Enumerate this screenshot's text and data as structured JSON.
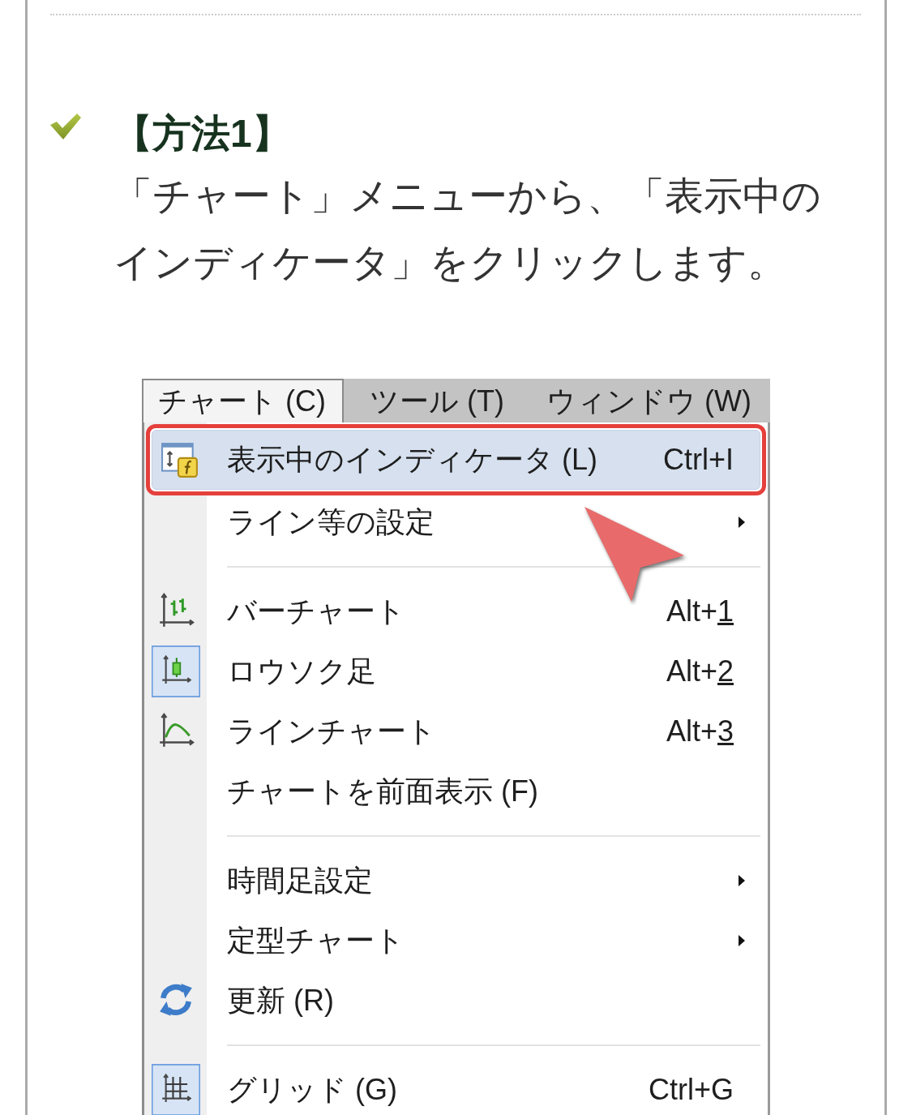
{
  "section": {
    "heading": "【方法1】",
    "text": "「チャート」メニューから、「表示中のインディケータ」をクリックします。"
  },
  "menu_bar": [
    {
      "label": "チャート (C)",
      "selected": true
    },
    {
      "label": "ツール (T)",
      "selected": false
    },
    {
      "label": "ウィンドウ (W)",
      "selected": false
    }
  ],
  "menu_groups": [
    {
      "items": [
        {
          "label": "表示中のインディケータ (L)",
          "shortcut": {
            "text": "Ctrl+I",
            "key_underlined": false
          },
          "selected": true,
          "outlined": true,
          "checked": false,
          "submenu": false
        },
        {
          "label": "ライン等の設定",
          "selected": false,
          "outlined": false,
          "checked": false,
          "submenu": true
        }
      ]
    },
    {
      "items": [
        {
          "label": "バーチャート",
          "shortcut": {
            "text": "Alt+1",
            "key_underlined": true
          },
          "selected": false,
          "outlined": false,
          "checked": false,
          "submenu": false
        },
        {
          "label": "ロウソク足",
          "shortcut": {
            "text": "Alt+2",
            "key_underlined": true
          },
          "selected": false,
          "outlined": false,
          "checked": true,
          "submenu": false
        },
        {
          "label": "ラインチャート",
          "shortcut": {
            "text": "Alt+3",
            "key_underlined": true
          },
          "selected": false,
          "outlined": false,
          "checked": false,
          "submenu": false
        },
        {
          "label": "チャートを前面表示 (F)",
          "selected": false,
          "outlined": false,
          "checked": false,
          "submenu": false
        }
      ]
    },
    {
      "items": [
        {
          "label": "時間足設定",
          "selected": false,
          "outlined": false,
          "checked": false,
          "submenu": true
        },
        {
          "label": "定型チャート",
          "selected": false,
          "outlined": false,
          "checked": false,
          "submenu": true
        },
        {
          "label": "更新 (R)",
          "selected": false,
          "outlined": false,
          "checked": false,
          "submenu": false
        }
      ]
    },
    {
      "items": [
        {
          "label": "グリッド (G)",
          "shortcut": {
            "text": "Ctrl+G",
            "key_underlined": false
          },
          "selected": false,
          "outlined": false,
          "checked": true,
          "submenu": false
        }
      ]
    }
  ]
}
